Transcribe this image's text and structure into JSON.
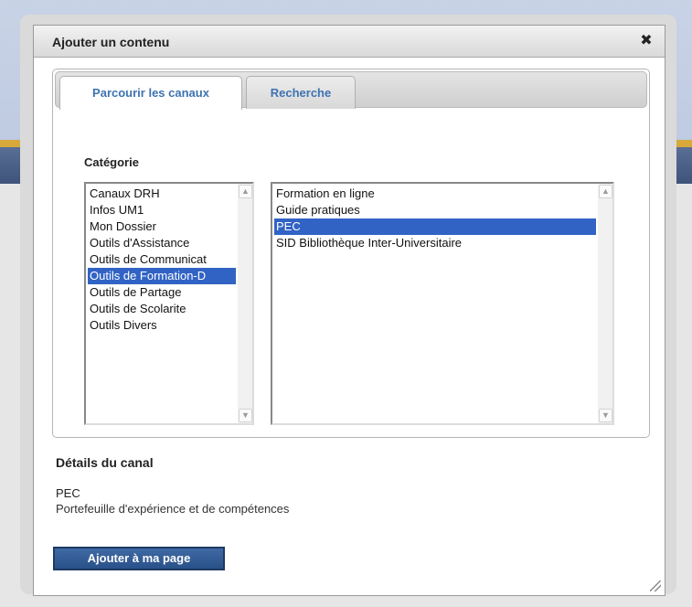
{
  "modal": {
    "title": "Ajouter un contenu",
    "close_glyph": "✖"
  },
  "tabs": [
    {
      "label": "Parcourir les canaux",
      "active": true
    },
    {
      "label": "Recherche",
      "active": false
    }
  ],
  "category_label": "Catégorie",
  "categories": {
    "items": [
      "Canaux DRH",
      "Infos UM1",
      "Mon Dossier",
      "Outils d'Assistance",
      "Outils de Communicat",
      "Outils de Formation-D",
      "Outils de Partage",
      "Outils de Scolarite",
      "Outils Divers"
    ],
    "selected": "Outils de Formation-D"
  },
  "channels": {
    "items": [
      "Formation en ligne",
      "Guide pratiques",
      "PEC",
      "SID Bibliothèque Inter-Universitaire"
    ],
    "selected": "PEC"
  },
  "details": {
    "heading": "Détails du canal",
    "name": "PEC",
    "description": "Portefeuille d'expérience et de compétences"
  },
  "add_button_label": "Ajouter à ma page",
  "colors": {
    "selection": "#3163c5",
    "tab_text": "#3e73b0",
    "button_bg": "#2f5a94"
  }
}
